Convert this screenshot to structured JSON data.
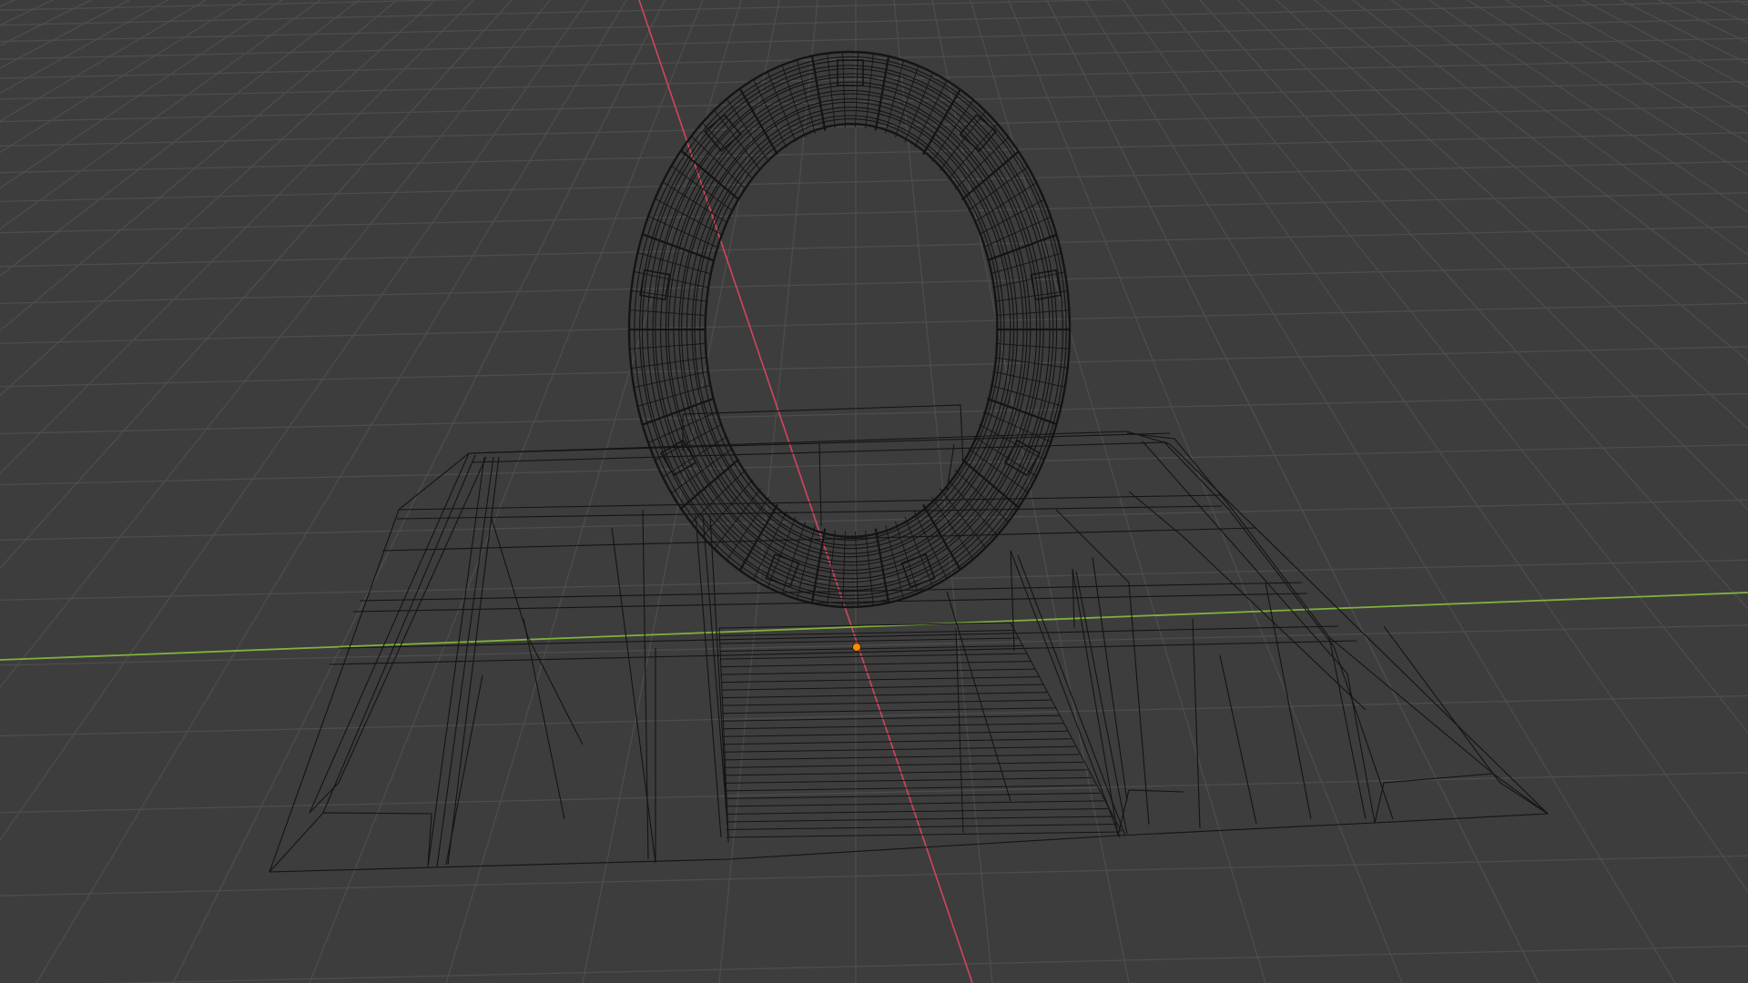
{
  "viewport": {
    "mode": "wireframe",
    "background_color": "#3d3d3d",
    "grid_color": "#4d4d4d",
    "x_axis_color": "#d3455a",
    "y_axis_color": "#7fb23c",
    "wire_color": "#141414",
    "origin_color": "#ff8a00"
  },
  "object": {
    "name_icon": "stargate-wireframe-mesh",
    "parts": [
      "ring",
      "chevrons",
      "platform",
      "ramp-stairs",
      "side-ramps"
    ]
  },
  "origin": {
    "icon": "object-origin-dot"
  }
}
